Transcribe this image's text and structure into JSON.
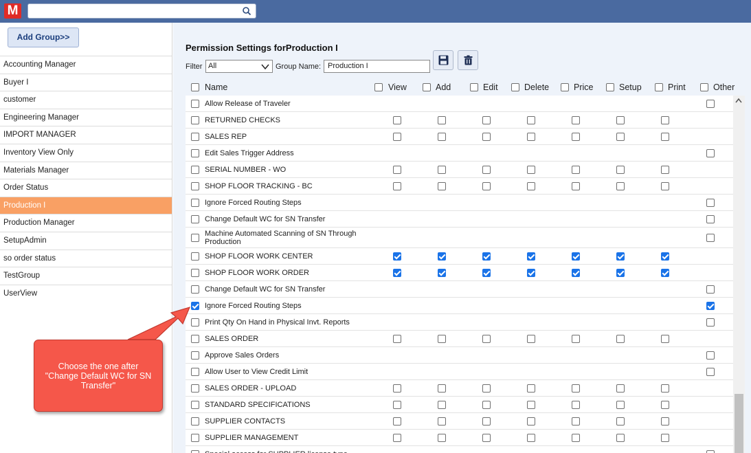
{
  "app": {
    "logo_letter": "M"
  },
  "search": {
    "value": ""
  },
  "sidebar": {
    "add_group_label": "Add Group>>",
    "groups": [
      {
        "label": "Accounting Manager",
        "active": false
      },
      {
        "label": "Buyer I",
        "active": false
      },
      {
        "label": "customer",
        "active": false
      },
      {
        "label": "Engineering Manager",
        "active": false
      },
      {
        "label": "IMPORT MANAGER",
        "active": false
      },
      {
        "label": "Inventory View Only",
        "active": false
      },
      {
        "label": "Materials Manager",
        "active": false
      },
      {
        "label": "Order Status",
        "active": false
      },
      {
        "label": "Production I",
        "active": true
      },
      {
        "label": "Production Manager",
        "active": false
      },
      {
        "label": "SetupAdmin",
        "active": false
      },
      {
        "label": "so order status",
        "active": false
      },
      {
        "label": "TestGroup",
        "active": false
      },
      {
        "label": "UserView",
        "active": false
      }
    ]
  },
  "main": {
    "title": "Permission Settings forProduction I",
    "filter_label": "Filter",
    "filter_value": "All",
    "group_name_label": "Group Name:",
    "group_name_value": "Production I",
    "save_icon": "save-icon",
    "delete_icon": "trash-icon"
  },
  "columns": {
    "name": "Name",
    "view": "View",
    "add": "Add",
    "edit": "Edit",
    "delete": "Delete",
    "price": "Price",
    "setup": "Setup",
    "print": "Print",
    "other": "Other"
  },
  "rows": [
    {
      "name": "Allow Release of Traveler",
      "sel": false,
      "perms": null,
      "other": false
    },
    {
      "name": "RETURNED CHECKS",
      "sel": false,
      "perms": [
        false,
        false,
        false,
        false,
        false,
        false,
        false
      ],
      "other": null
    },
    {
      "name": "SALES REP",
      "sel": false,
      "perms": [
        false,
        false,
        false,
        false,
        false,
        false,
        false
      ],
      "other": null
    },
    {
      "name": "Edit Sales Trigger Address",
      "sel": false,
      "perms": null,
      "other": false
    },
    {
      "name": "SERIAL NUMBER - WO",
      "sel": false,
      "perms": [
        false,
        false,
        false,
        false,
        false,
        false,
        false
      ],
      "other": null
    },
    {
      "name": "SHOP FLOOR TRACKING - BC",
      "sel": false,
      "perms": [
        false,
        false,
        false,
        false,
        false,
        false,
        false
      ],
      "other": null
    },
    {
      "name": "Ignore Forced Routing Steps",
      "sel": false,
      "perms": null,
      "other": false
    },
    {
      "name": "Change Default WC for SN Transfer",
      "sel": false,
      "perms": null,
      "other": false
    },
    {
      "name": "Machine Automated Scanning of SN Through Production",
      "sel": false,
      "perms": null,
      "other": false,
      "tall": true
    },
    {
      "name": "SHOP FLOOR WORK CENTER",
      "sel": false,
      "perms": [
        true,
        true,
        true,
        true,
        true,
        true,
        true
      ],
      "other": null
    },
    {
      "name": "SHOP FLOOR WORK ORDER",
      "sel": false,
      "perms": [
        true,
        true,
        true,
        true,
        true,
        true,
        true
      ],
      "other": null
    },
    {
      "name": "Change Default WC for SN Transfer",
      "sel": false,
      "perms": null,
      "other": false
    },
    {
      "name": "Ignore Forced Routing Steps",
      "sel": true,
      "perms": null,
      "other": true
    },
    {
      "name": "Print Qty On Hand in Physical Invt. Reports",
      "sel": false,
      "perms": null,
      "other": false
    },
    {
      "name": "SALES ORDER",
      "sel": false,
      "perms": [
        false,
        false,
        false,
        false,
        false,
        false,
        false
      ],
      "other": null
    },
    {
      "name": "Approve Sales Orders",
      "sel": false,
      "perms": null,
      "other": false
    },
    {
      "name": "Allow User to View Credit Limit",
      "sel": false,
      "perms": null,
      "other": false
    },
    {
      "name": "SALES ORDER - UPLOAD",
      "sel": false,
      "perms": [
        false,
        false,
        false,
        false,
        false,
        false,
        false
      ],
      "other": null
    },
    {
      "name": "STANDARD SPECIFICATIONS",
      "sel": false,
      "perms": [
        false,
        false,
        false,
        false,
        false,
        false,
        false
      ],
      "other": null
    },
    {
      "name": "SUPPLIER CONTACTS",
      "sel": false,
      "perms": [
        false,
        false,
        false,
        false,
        false,
        false,
        false
      ],
      "other": null
    },
    {
      "name": "SUPPLIER MANAGEMENT",
      "sel": false,
      "perms": [
        false,
        false,
        false,
        false,
        false,
        false,
        false
      ],
      "other": null
    },
    {
      "name": "Special access for SUPPLIER license type",
      "sel": false,
      "perms": null,
      "other": false
    }
  ],
  "callout": {
    "text": "Choose the one after \"Change Default WC for SN Transfer\""
  },
  "colors": {
    "topbar": "#4a6aa0",
    "active_group": "#f9a064",
    "callout": "#f5574a",
    "checked": "#1a73e8"
  }
}
